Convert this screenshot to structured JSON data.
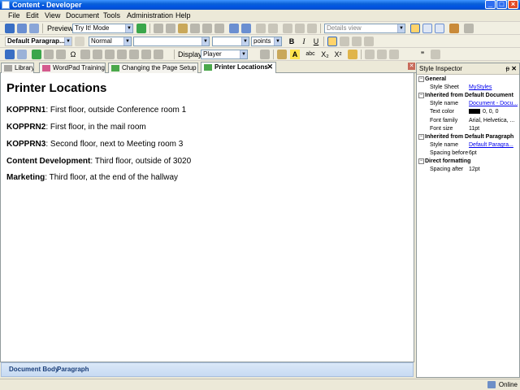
{
  "window": {
    "title": "Content - Developer",
    "controls": {
      "minimize": "_",
      "maximize": "□",
      "close": "×"
    }
  },
  "menu": [
    "File",
    "Edit",
    "View",
    "Document",
    "Tools",
    "Administration",
    "Help"
  ],
  "toolbar1": {
    "preview_label": "Preview:",
    "preview_value": "Try It! Mode",
    "view_value": "Details view"
  },
  "toolbar2": {
    "style_value": "Default Paragrap...",
    "normal_value": "Normal",
    "font_value": "",
    "size_value": "",
    "units_value": "points",
    "bold": "B",
    "italic": "I",
    "underline": "U"
  },
  "toolbar3": {
    "display_label": "Display:",
    "display_value": "Player",
    "abc": "abc",
    "subscript": "X₂",
    "superscript": "X²",
    "omega": "Ω"
  },
  "tabs": [
    {
      "label": "Library"
    },
    {
      "label": "WordPad Training"
    },
    {
      "label": "Changing the Page Setup"
    },
    {
      "label": "Printer Locations"
    }
  ],
  "document": {
    "title": "Printer Locations",
    "lines": [
      {
        "name": "KOPPRN1",
        "text": ":  First floor, outside Conference room 1"
      },
      {
        "name": "KOPPRN2",
        "text": ":  First floor, in the mail room"
      },
      {
        "name": "KOPPRN3",
        "text": ":  Second floor, next to Meeting room 3"
      },
      {
        "name": "Content Development",
        "text": ":  Third floor, outside of 3020"
      },
      {
        "name": "Marketing",
        "text": ":  Third floor, at the end of the hallway"
      }
    ],
    "status_path": [
      "Document Body",
      "Paragraph"
    ]
  },
  "inspector": {
    "title": "Style Inspector",
    "sections": {
      "general": "General",
      "inherited_doc": "Inherited from Default Document",
      "inherited_para": "Inherited from Default Paragraph",
      "direct": "Direct formatting"
    },
    "rows": {
      "style_sheet_k": "Style Sheet",
      "style_sheet_v": "MyStyles",
      "doc_style_name_k": "Style name",
      "doc_style_name_v": "Document - Docu...",
      "text_color_k": "Text color",
      "text_color_v": "0, 0, 0",
      "font_family_k": "Font family",
      "font_family_v": "Arial, Helvetica, ...",
      "font_size_k": "Font size",
      "font_size_v": "11pt",
      "para_style_name_k": "Style name",
      "para_style_name_v": "Default Paragra...",
      "spacing_before_k": "Spacing before",
      "spacing_before_v": "6pt",
      "spacing_after_k": "Spacing after",
      "spacing_after_v": "12pt"
    },
    "text_color_swatch": "#000000"
  },
  "status": {
    "online": "Online"
  }
}
